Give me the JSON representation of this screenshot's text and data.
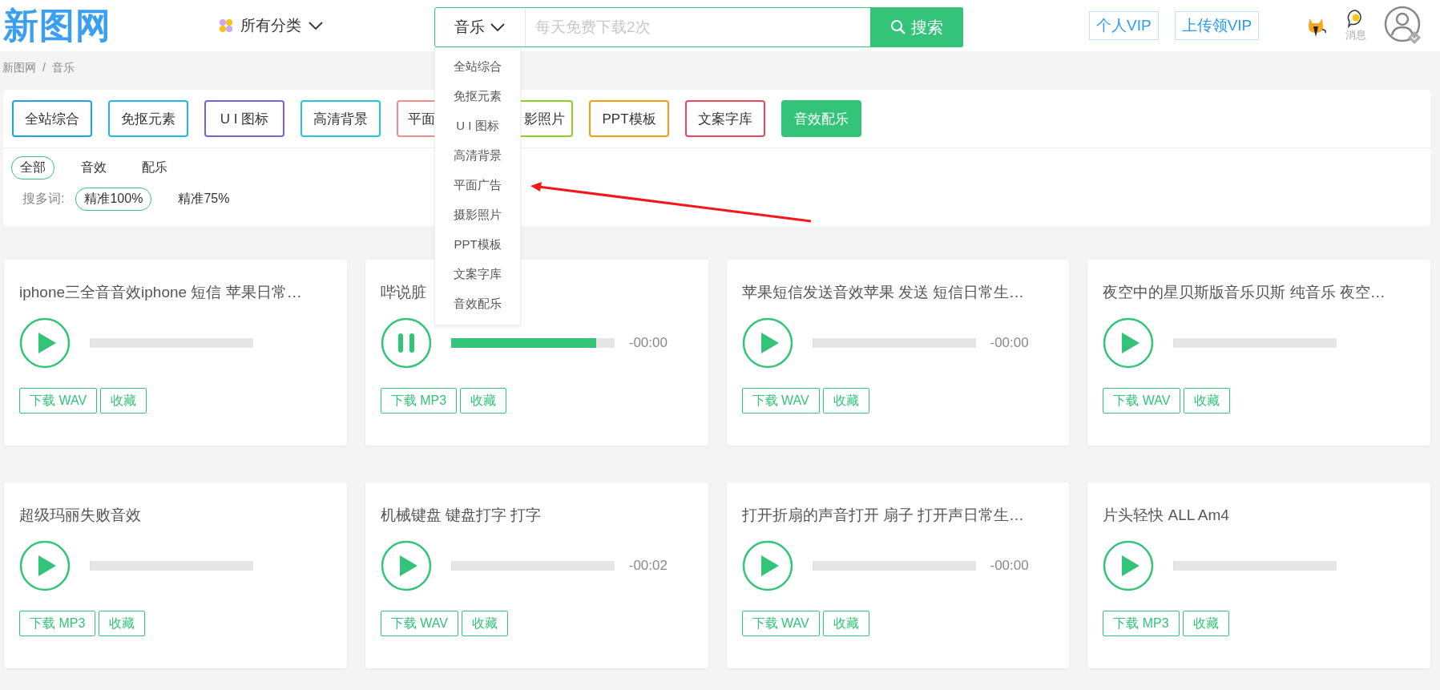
{
  "header": {
    "logo": "新图网",
    "all_categories": "所有分类",
    "search": {
      "category": "音乐",
      "placeholder": "每天免费下载2次",
      "button": "搜索"
    },
    "vip_buttons": [
      "个人VIP",
      "上传领VIP"
    ],
    "messages": "消息"
  },
  "dropdown": {
    "items": [
      "全站综合",
      "免抠元素",
      "U I 图标",
      "高清背景",
      "平面广告",
      "摄影照片",
      "PPT模板",
      "文案字库",
      "音效配乐"
    ]
  },
  "breadcrumb": {
    "items": [
      "新图网",
      "音乐"
    ],
    "separator": "/"
  },
  "category_tabs": [
    {
      "label": "全站综合",
      "color": "#1ea0f0",
      "selected": false
    },
    {
      "label": "免抠元素",
      "color": "#20b8e8",
      "selected": false
    },
    {
      "label": "U I 图标",
      "color": "#7a5fe0",
      "selected": false
    },
    {
      "label": "高清背景",
      "color": "#20c8d8",
      "selected": false
    },
    {
      "label": "平面",
      "color": "#f58a8a",
      "selected": false
    },
    {
      "label": "影照片",
      "color": "#8ad02a",
      "selected": false
    },
    {
      "label": "PPT模板",
      "color": "#fa9a10",
      "selected": false
    },
    {
      "label": "文案字库",
      "color": "#e84a5a",
      "selected": false
    },
    {
      "label": "音效配乐",
      "color": "#33c47a",
      "selected": true
    }
  ],
  "type_filters": [
    {
      "label": "全部",
      "selected": true
    },
    {
      "label": "音效",
      "selected": false
    },
    {
      "label": "配乐",
      "selected": false
    }
  ],
  "match_filter": {
    "label": "搜多词:",
    "options": [
      {
        "label": "精准100%",
        "selected": true
      },
      {
        "label": "精准75%",
        "selected": false
      }
    ]
  },
  "cards": [
    {
      "title": "iphone三全音音效iphone 短信 苹果日常…",
      "playing": false,
      "level": 0,
      "download": "下载 WAV",
      "favorite": "收藏"
    },
    {
      "title": "哔说脏",
      "playing": true,
      "level": 0.89,
      "time": "-00:00",
      "download": "下载 MP3",
      "favorite": "收藏"
    },
    {
      "title": "苹果短信发送音效苹果 发送 短信日常生…",
      "playing": false,
      "level": 0,
      "time": "-00:00",
      "download": "下载 WAV",
      "favorite": "收藏"
    },
    {
      "title": "夜空中的星贝斯版音乐贝斯 纯音乐 夜空…",
      "playing": false,
      "level": 0,
      "download": "下载 WAV",
      "favorite": "收藏"
    },
    {
      "title": "超级玛丽失败音效",
      "playing": false,
      "level": 0,
      "download": "下载 MP3",
      "favorite": "收藏"
    },
    {
      "title": "机械键盘 键盘打字 打字",
      "playing": false,
      "level": 0,
      "time": "-00:02",
      "download": "下载 WAV",
      "favorite": "收藏"
    },
    {
      "title": "打开折扇的声音打开 扇子 打开声日常生…",
      "playing": false,
      "level": 0,
      "time": "-00:00",
      "download": "下载 WAV",
      "favorite": "收藏"
    },
    {
      "title": "片头轻快 ALL Am4",
      "playing": false,
      "level": 0,
      "download": "下载 MP3",
      "favorite": "收藏"
    }
  ]
}
